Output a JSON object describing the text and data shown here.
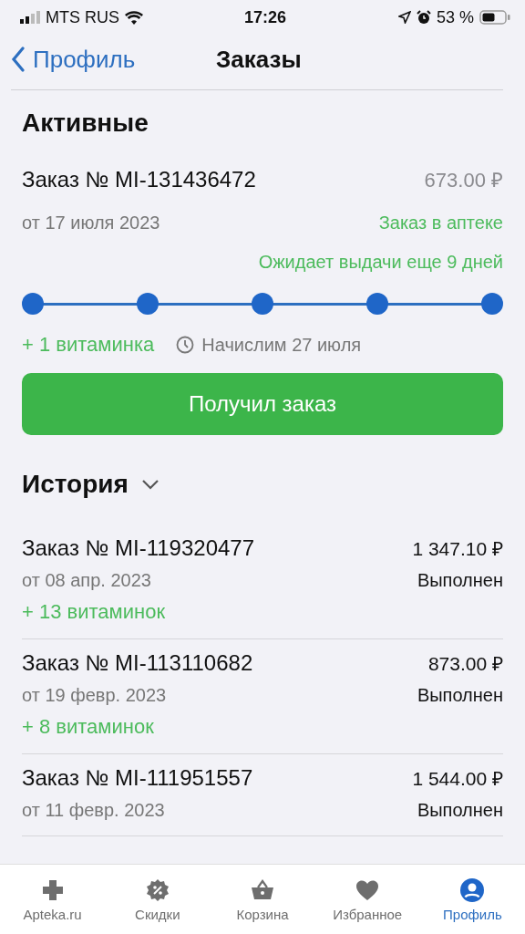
{
  "status_bar": {
    "carrier": "MTS RUS",
    "time": "17:26",
    "battery": "53 %"
  },
  "nav": {
    "back": "Профиль",
    "title": "Заказы"
  },
  "active": {
    "heading": "Активные",
    "order": {
      "number": "Заказ № MI-131436472",
      "price": "673.00 ₽",
      "date": "от 17 июля 2023",
      "status": "Заказ в аптеке",
      "note": "Ожидает выдачи еще 9 дней",
      "steps": [
        {
          "done": true
        },
        {
          "done": true
        },
        {
          "done": true
        },
        {
          "done": true
        },
        {
          "done": true
        }
      ],
      "bonus": "+ 1 витаминка",
      "accrual": "Начислим 27 июля",
      "button": "Получил заказ"
    }
  },
  "history": {
    "heading": "История",
    "expanded": true,
    "orders": [
      {
        "number": "Заказ № MI-119320477",
        "price": "1 347.10 ₽",
        "date": "от 08 апр. 2023",
        "status": "Выполнен",
        "bonus": "+ 13 витаминок"
      },
      {
        "number": "Заказ № MI-113110682",
        "price": "873.00 ₽",
        "date": "от 19 февр. 2023",
        "status": "Выполнен",
        "bonus": "+ 8 витаминок"
      },
      {
        "number": "Заказ № MI-111951557",
        "price": "1 544.00 ₽",
        "date": "от 11 февр. 2023",
        "status": "Выполнен"
      }
    ]
  },
  "tab_bar": [
    {
      "label": "Apteka.ru",
      "selected": false
    },
    {
      "label": "Скидки",
      "selected": false
    },
    {
      "label": "Корзина",
      "selected": false
    },
    {
      "label": "Избранное",
      "selected": false
    },
    {
      "label": "Профиль",
      "selected": true
    }
  ]
}
